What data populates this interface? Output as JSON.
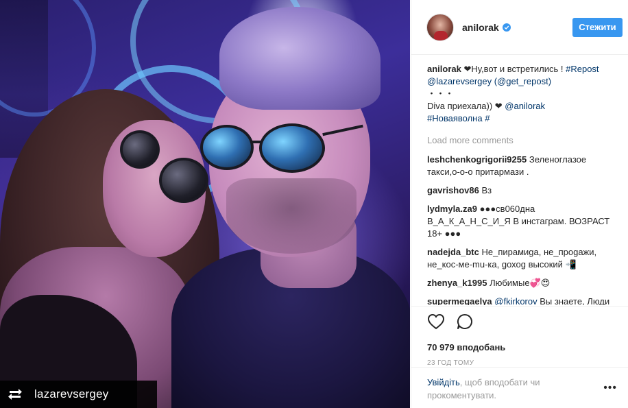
{
  "post": {
    "repost_badge": "lazarevsergey"
  },
  "author": {
    "username": "anilorak",
    "follow_label": "Стежити"
  },
  "caption": {
    "username": "anilorak",
    "line1_text": " ❤Ну,вот и встретились ! ",
    "line1_tag": "#Repost",
    "line2_mention": "@lazarevsergey",
    "line2_rest": " (@get_repost)",
    "line3": "・・・",
    "line4_text": "Diva приехала)) ❤ ",
    "line4_mention": "@anilorak",
    "line5_tag": "#Новаяволна",
    "line5_rest": " #"
  },
  "load_more": "Load more comments",
  "comments": [
    {
      "user": "leshchenkogrigorii9255",
      "text": " Зеленоглазое такси,о-о-о притармази ."
    },
    {
      "user": "gavrishov86",
      "text": " Вз"
    },
    {
      "user": "lydmyla.za9",
      "text": " ●●●св060дна В_А_К_А_Н_С_И_Я В инстаграм. ВОЗРАСТ 18+ ●●●"
    },
    {
      "user": "nadejda_btc",
      "text": " Не_пирамиgа, не_проgажи, не_кос-ме-mu-ка, gохоg высокий 📲"
    },
    {
      "user": "zhenya_k1995",
      "text": " Любимые💞😍"
    },
    {
      "user": "supermegaelya",
      "mention": "@fkirkorov",
      "text": " Вы знаете, Люди любят талантливых и красивых ..но"
    }
  ],
  "stats": {
    "likes": "70 979 вподобань",
    "time": "23 ГОД ТОМУ"
  },
  "login": {
    "link": "Увійдіть",
    "text": ", щоб вподобати чи прокоментувати."
  },
  "more": "•••"
}
